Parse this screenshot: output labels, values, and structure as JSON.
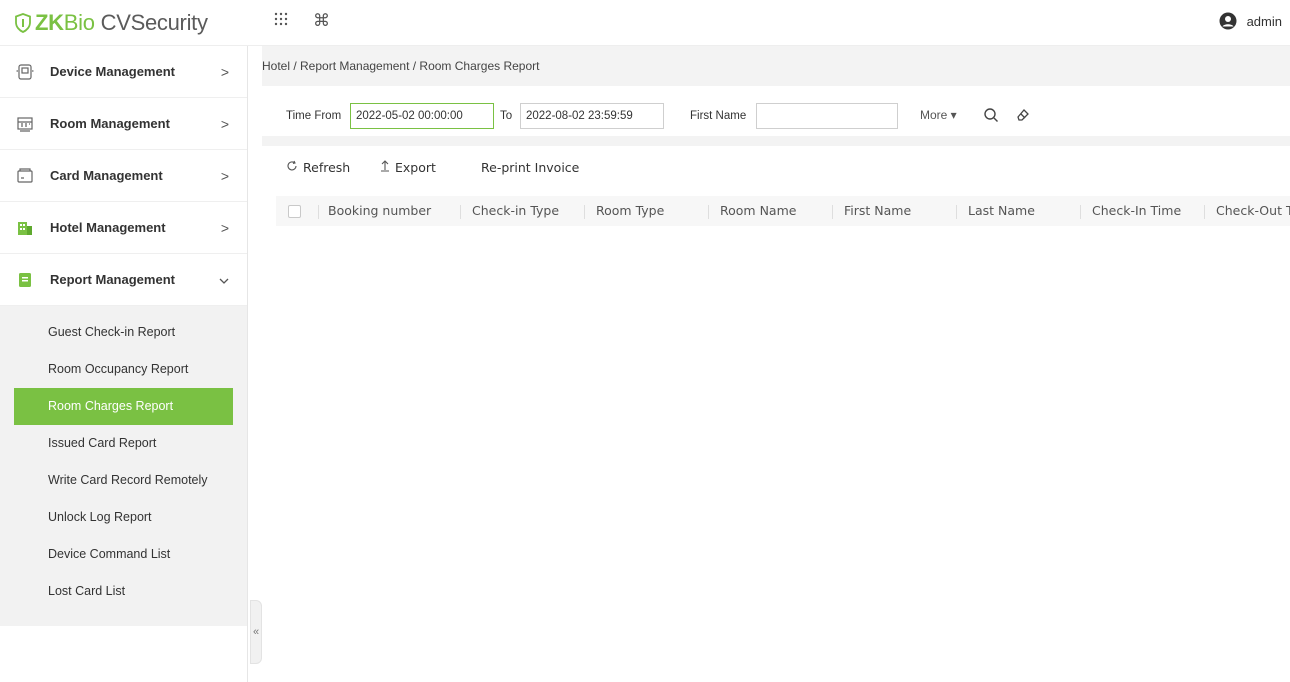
{
  "app": {
    "logo_zk": "ZK",
    "logo_bio": "Bio",
    "logo_cv": "CVSecurity",
    "user": "admin",
    "accent": "#7ac143"
  },
  "sidebar": {
    "items": [
      {
        "label": "Device Management",
        "icon": "device-management-icon",
        "chevron": ">"
      },
      {
        "label": "Room Management",
        "icon": "room-management-icon",
        "chevron": ">"
      },
      {
        "label": "Card Management",
        "icon": "card-management-icon",
        "chevron": ">"
      },
      {
        "label": "Hotel Management",
        "icon": "hotel-management-icon",
        "chevron": ">"
      },
      {
        "label": "Report Management",
        "icon": "report-management-icon",
        "chevron": "⌄"
      }
    ],
    "subitems": [
      {
        "label": "Guest Check-in Report"
      },
      {
        "label": "Room Occupancy Report"
      },
      {
        "label": "Room Charges Report"
      },
      {
        "label": "Issued Card Report"
      },
      {
        "label": "Write Card Record Remotely"
      },
      {
        "label": "Unlock Log Report"
      },
      {
        "label": "Device Command List"
      },
      {
        "label": "Lost Card List"
      }
    ],
    "active_subitem": "Room Charges Report",
    "collapse_glyph": "«"
  },
  "breadcrumb": "Hotel / Report Management / Room Charges Report",
  "filters": {
    "time_from_label": "Time From",
    "time_from_value": "2022-05-02 00:00:00",
    "to_label": "To",
    "to_value": "2022-08-02 23:59:59",
    "first_name_label": "First Name",
    "first_name_value": "",
    "more_label": "More ▾"
  },
  "toolbar": {
    "refresh_label": "Refresh",
    "export_label": "Export",
    "reprint_label": "Re-print Invoice"
  },
  "table": {
    "columns": [
      "Booking number",
      "Check-in Type",
      "Room Type",
      "Room Name",
      "First Name",
      "Last Name",
      "Check-In Time",
      "Check-Out Time"
    ],
    "rows": []
  }
}
